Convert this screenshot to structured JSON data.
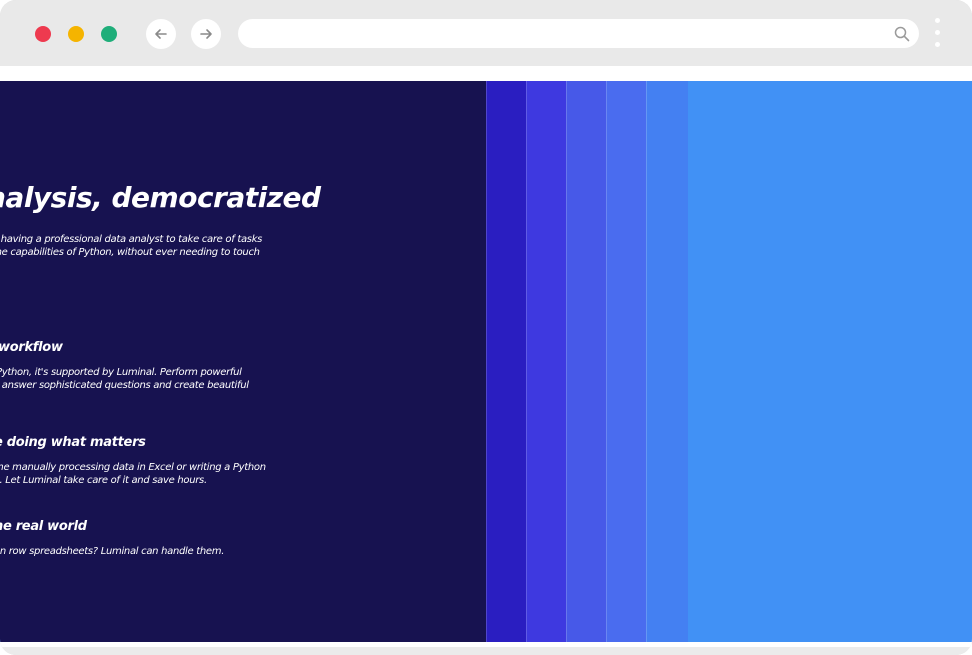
{
  "browser": {
    "url_value": "",
    "url_placeholder": "",
    "icons": {
      "back": "arrow-left-icon",
      "forward": "arrow-right-icon",
      "search": "search-icon",
      "menu": "more-vertical-icon"
    },
    "colors": {
      "close": "#ee3a4f",
      "minimize": "#f5b400",
      "maximize": "#1fae7a"
    }
  },
  "hero": {
    "title": "nalysis, democratized",
    "subtitle_lines": [
      "e having a professional data analyst to take care of tasks",
      "the capabilities of Python, without ever needing to touch"
    ]
  },
  "features": [
    {
      "title": "workflow",
      "desc_lines": [
        "Python, it's supported by Luminal. Perform powerful",
        ", answer sophisticated questions and create beautiful"
      ]
    },
    {
      "title": "e doing what matters",
      "desc_lines": [
        "me manually processing data in Excel or writing a Python",
        "k. Let Luminal take care of it and save hours."
      ]
    },
    {
      "title": "ne real world",
      "desc_lines": [
        "on row spreadsheets? Luminal can handle them."
      ]
    }
  ],
  "theme": {
    "panel_dark": "#171250",
    "stripes": [
      "#2a1ec1",
      "#3e39e0",
      "#4759e8",
      "#4a6cef",
      "#4480f2"
    ],
    "background_blue": "#4191f5"
  }
}
